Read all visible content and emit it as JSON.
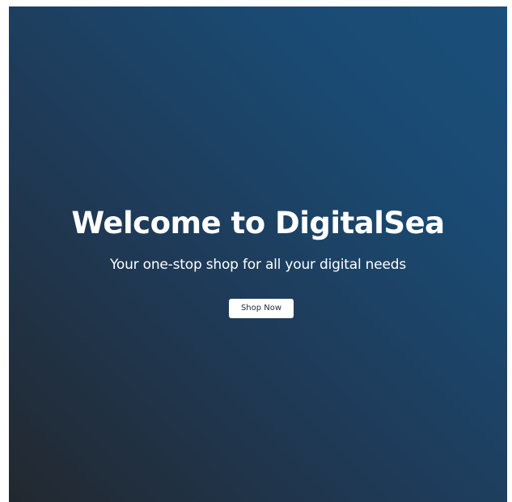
{
  "hero": {
    "title": "Welcome to DigitalSea",
    "subtitle": "Your one-stop shop for all your digital needs",
    "cta_label": "Shop Now"
  },
  "colors": {
    "background_start": "#22282f",
    "background_end": "#1a4f7a",
    "text": "#ffffff",
    "button_background": "#ffffff",
    "button_text": "#1d2a38"
  }
}
